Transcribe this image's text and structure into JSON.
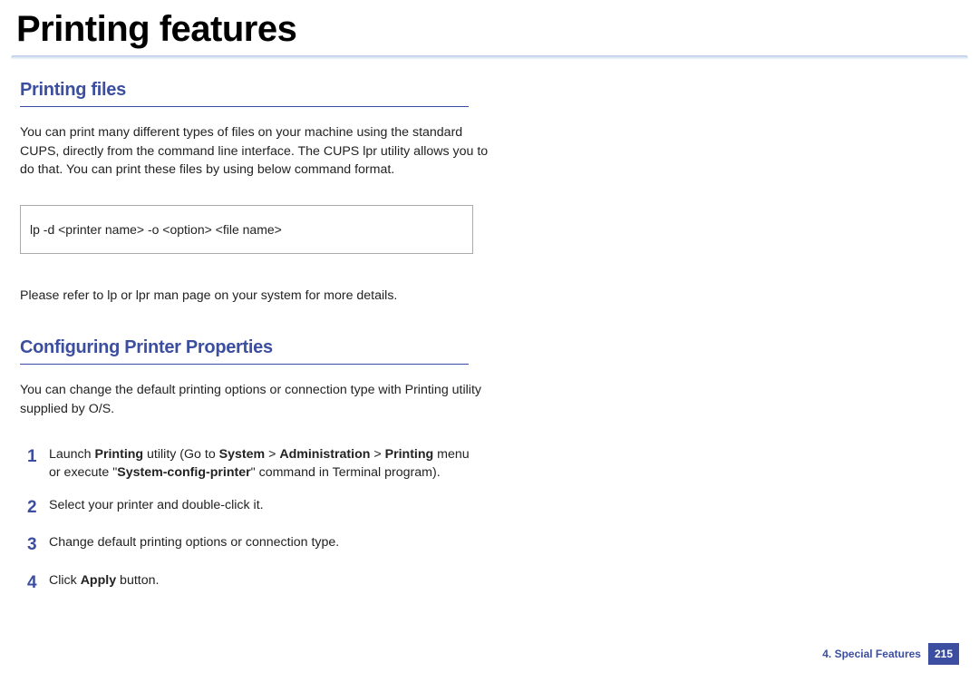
{
  "title": "Printing features",
  "section1": {
    "heading": "Printing files",
    "paragraph": "You can print many different types of files on your machine using the standard CUPS, directly from the command line interface. The CUPS lpr utility allows you to do that. You can print these files by using below command format.",
    "command": "lp -d <printer name> -o <option> <file name>",
    "note": "Please refer to lp or lpr man page on your system for more details."
  },
  "section2": {
    "heading": "Configuring Printer Properties",
    "paragraph": "You can change the default printing options or connection type with Printing utility supplied by O/S.",
    "steps": {
      "s1": {
        "num": "1",
        "pre": "Launch ",
        "b1": "Printing",
        "mid1": " utility (Go to ",
        "b2": "System",
        "sep1": " > ",
        "b3": "Administration",
        "sep2": " > ",
        "b4": "Printing",
        "mid2": " menu or execute \"",
        "b5": "System-config-printer",
        "post": "\" command in Terminal program)."
      },
      "s2": {
        "num": "2",
        "text": "Select your printer and double-click it."
      },
      "s3": {
        "num": "3",
        "text": "Change default printing options or connection type."
      },
      "s4": {
        "num": "4",
        "pre": "Click ",
        "b1": "Apply",
        "post": " button."
      }
    }
  },
  "footer": {
    "chapter": "4.  Special Features",
    "page": "215"
  }
}
